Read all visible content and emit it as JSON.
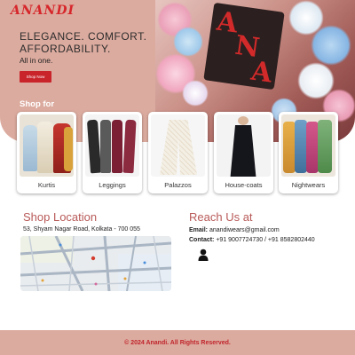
{
  "brand": {
    "logo_text": "ANANDI",
    "accent_color": "#d6262b",
    "hero_color": "#dcab9f"
  },
  "hero": {
    "tagline_line1": "ELEGANCE. COMFORT.",
    "tagline_line2": "AFFORDABILITY.",
    "subtitle": "All in one.",
    "cta_label": "Shop Now",
    "sign_letters": "ANA"
  },
  "shop_for": {
    "heading": "Shop for",
    "categories": [
      {
        "label": "Kurtis"
      },
      {
        "label": "Leggings"
      },
      {
        "label": "Palazzos"
      },
      {
        "label": "House-coats"
      },
      {
        "label": "Nightwears"
      }
    ]
  },
  "location": {
    "heading": "Shop Location",
    "address": "53, Shyam Nagar Road, Kolkata - 700 055"
  },
  "contact": {
    "heading": "Reach Us at",
    "email_label": "Email:",
    "email": "anandiwears@gmail.com",
    "phone_label": "Contact:",
    "phones": "+91 9007724730 / +91 8582802440",
    "icon": "person-icon"
  },
  "footer": {
    "copyright": "© 2024 Anandi. All Rights Reserved."
  }
}
